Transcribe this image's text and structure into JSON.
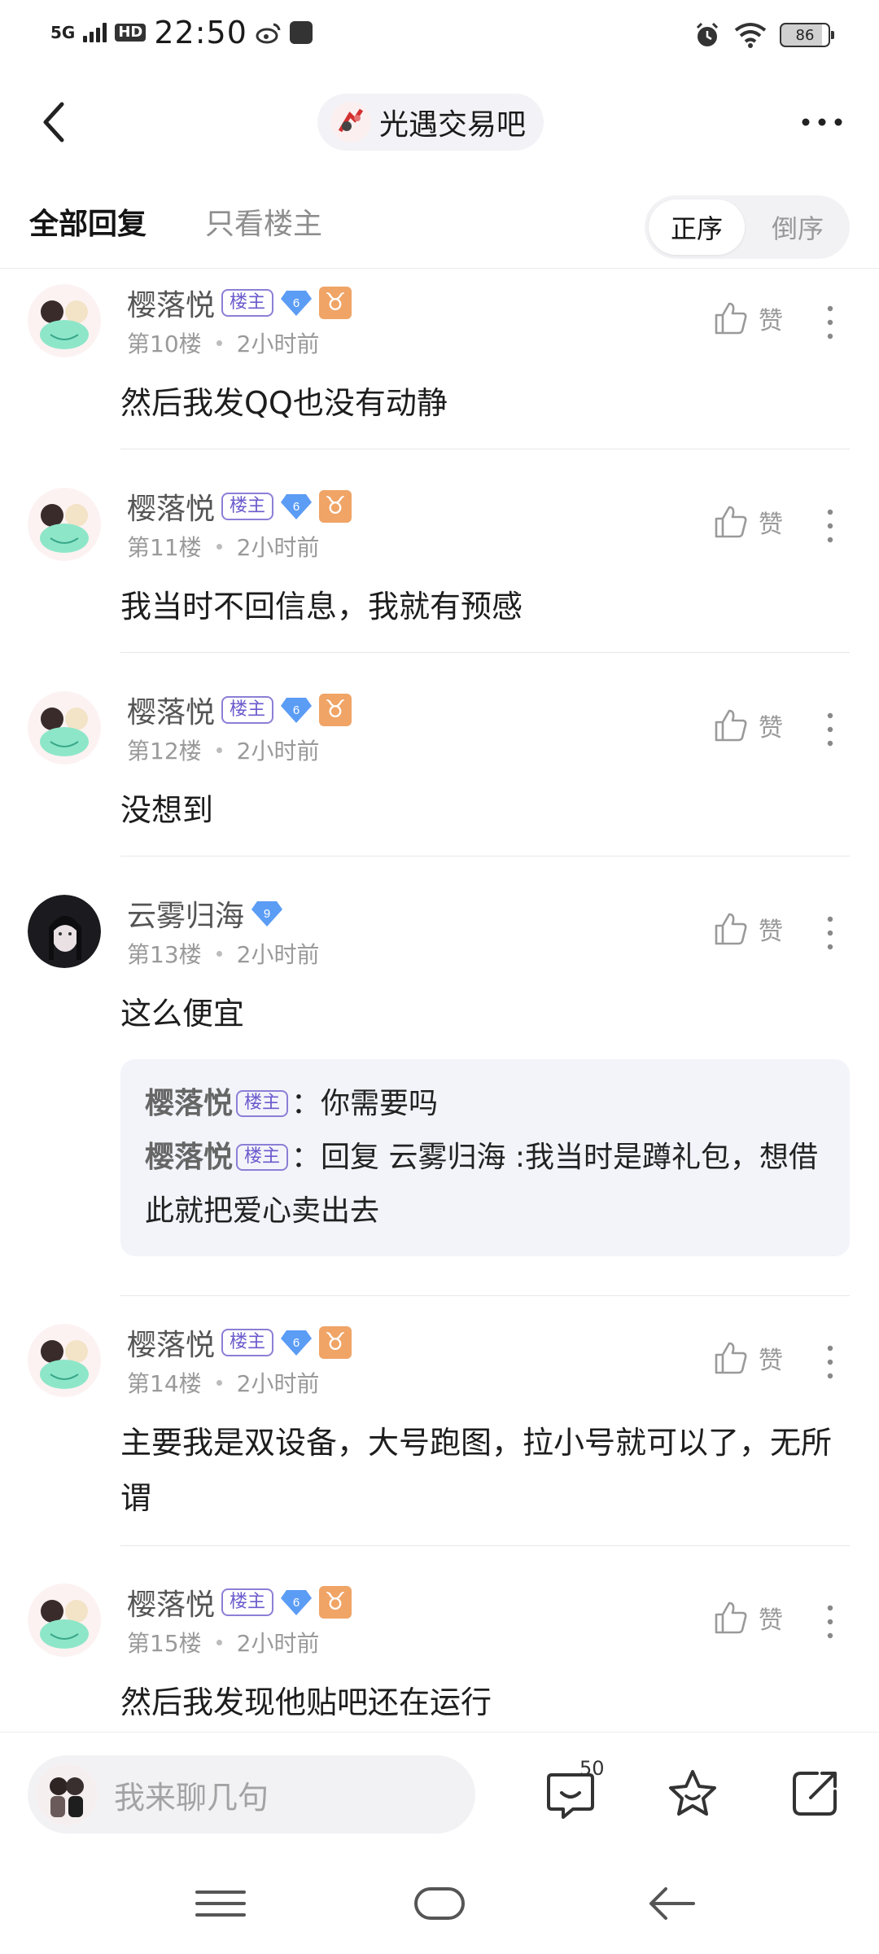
{
  "status_bar": {
    "network": "5G",
    "hd": "HD",
    "time": "22:50",
    "battery": "86"
  },
  "nav": {
    "forum_name": "光遇交易吧"
  },
  "tabs": {
    "all_replies": "全部回复",
    "only_op": "只看楼主",
    "order_asc": "正序",
    "order_desc": "倒序"
  },
  "posts": [
    {
      "user": "樱落悦",
      "op_tag": "楼主",
      "level": "6",
      "floor": "第10楼",
      "time": "2小时前",
      "like_label": "赞",
      "content": "然后我发QQ也没有动静"
    },
    {
      "user": "樱落悦",
      "op_tag": "楼主",
      "level": "6",
      "floor": "第11楼",
      "time": "2小时前",
      "like_label": "赞",
      "content": "我当时不回信息，我就有预感"
    },
    {
      "user": "樱落悦",
      "op_tag": "楼主",
      "level": "6",
      "floor": "第12楼",
      "time": "2小时前",
      "like_label": "赞",
      "content": "没想到"
    },
    {
      "user": "云雾归海",
      "level": "9",
      "floor": "第13楼",
      "time": "2小时前",
      "like_label": "赞",
      "content": "这么便宜",
      "replies": [
        {
          "name": "樱落悦",
          "tag": "楼主",
          "text": "：你需要吗"
        },
        {
          "name": "樱落悦",
          "tag": "楼主",
          "text": "：回复 云雾归海 :我当时是蹲礼包，想借此就把爱心卖出去"
        }
      ]
    },
    {
      "user": "樱落悦",
      "op_tag": "楼主",
      "level": "6",
      "floor": "第14楼",
      "time": "2小时前",
      "like_label": "赞",
      "content": "主要我是双设备，大号跑图，拉小号就可以了，无所谓"
    },
    {
      "user": "樱落悦",
      "op_tag": "楼主",
      "level": "6",
      "floor": "第15楼",
      "time": "2小时前",
      "like_label": "赞",
      "content": "然后我发现他贴吧还在运行"
    }
  ],
  "bottom_bar": {
    "input_placeholder": "我来聊几句",
    "comment_count": "50"
  },
  "colors": {
    "op_tag": "#6a5acd",
    "zodiac": "#f0a466",
    "level_badge": "#5b9cf5",
    "reply_bg": "#f3f4fa"
  }
}
